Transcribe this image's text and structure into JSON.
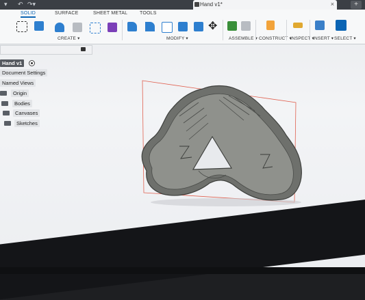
{
  "window": {
    "document_tab": "Hand v1*"
  },
  "ribbon": {
    "tabs": [
      "SOLID",
      "SURFACE",
      "SHEET METAL",
      "TOOLS"
    ],
    "active_tab": "SOLID",
    "groups": {
      "create": "CREATE ▾",
      "modify": "MODIFY ▾",
      "assemble": "ASSEMBLE ▾",
      "construct": "CONSTRUCT ▾",
      "inspect": "INSPECT ▾",
      "insert": "INSERT ▾",
      "select": "SELECT ▾"
    }
  },
  "browser": {
    "root": "Hand v1",
    "items": [
      "Document Settings",
      "Named Views",
      "Origin",
      "Bodies",
      "Canvases",
      "Sketches"
    ]
  },
  "colors": {
    "accent": "#0a64b4",
    "sketch_outline": "#e0604f",
    "model_body": "#8f918c",
    "model_rim": "#6e706c"
  }
}
